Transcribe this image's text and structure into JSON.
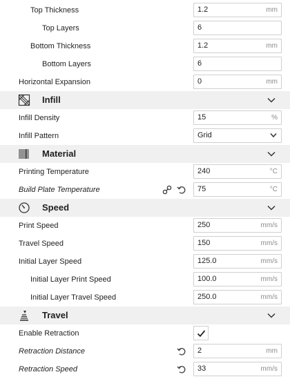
{
  "settings": {
    "top_thickness": {
      "label": "Top Thickness",
      "value": "1.2",
      "unit": "mm"
    },
    "top_layers": {
      "label": "Top Layers",
      "value": "6"
    },
    "bottom_thickness": {
      "label": "Bottom Thickness",
      "value": "1.2",
      "unit": "mm"
    },
    "bottom_layers": {
      "label": "Bottom Layers",
      "value": "6"
    },
    "horizontal_expansion": {
      "label": "Horizontal Expansion",
      "value": "0",
      "unit": "mm"
    }
  },
  "infill": {
    "title": "Infill",
    "icon": "infill-icon",
    "density": {
      "label": "Infill Density",
      "value": "15",
      "unit": "%"
    },
    "pattern": {
      "label": "Infill Pattern",
      "value": "Grid"
    }
  },
  "material": {
    "title": "Material",
    "icon": "material-icon",
    "printing_temperature": {
      "label": "Printing Temperature",
      "value": "240",
      "unit": "°C"
    },
    "build_plate_temperature": {
      "label": "Build Plate Temperature",
      "value": "75",
      "unit": "°C"
    }
  },
  "speed": {
    "title": "Speed",
    "icon": "speedometer-icon",
    "print_speed": {
      "label": "Print Speed",
      "value": "250",
      "unit": "mm/s"
    },
    "travel_speed": {
      "label": "Travel Speed",
      "value": "150",
      "unit": "mm/s"
    },
    "initial_layer_speed": {
      "label": "Initial Layer Speed",
      "value": "125.0",
      "unit": "mm/s"
    },
    "initial_layer_print_speed": {
      "label": "Initial Layer Print Speed",
      "value": "100.0",
      "unit": "mm/s"
    },
    "initial_layer_travel_speed": {
      "label": "Initial Layer Travel Speed",
      "value": "250.0",
      "unit": "mm/s"
    }
  },
  "travel": {
    "title": "Travel",
    "icon": "travel-icon",
    "enable_retraction": {
      "label": "Enable Retraction",
      "checked": true
    },
    "retraction_distance": {
      "label": "Retraction Distance",
      "value": "2",
      "unit": "mm"
    },
    "retraction_speed": {
      "label": "Retraction Speed",
      "value": "33",
      "unit": "mm/s"
    }
  }
}
